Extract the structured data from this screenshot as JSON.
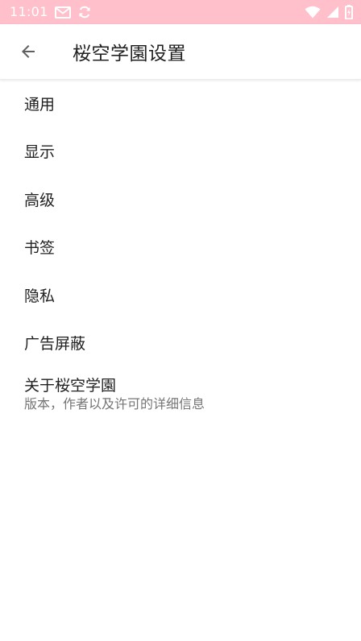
{
  "status_bar": {
    "time": "11:01",
    "left_icons": [
      "mail-icon",
      "sync-icon"
    ],
    "right_icons": [
      "wifi-icon",
      "signal-icon",
      "battery-charging-icon"
    ],
    "background_color": "#ffc0cb"
  },
  "app_bar": {
    "back_icon": "arrow-back-icon",
    "title": "桜空学園设置"
  },
  "settings": {
    "items": [
      {
        "title": "通用"
      },
      {
        "title": "显示"
      },
      {
        "title": "高级"
      },
      {
        "title": "书签"
      },
      {
        "title": "隐私"
      },
      {
        "title": "广告屏蔽"
      },
      {
        "title": "关于桜空学園",
        "summary": "版本，作者以及许可的详细信息"
      }
    ]
  }
}
